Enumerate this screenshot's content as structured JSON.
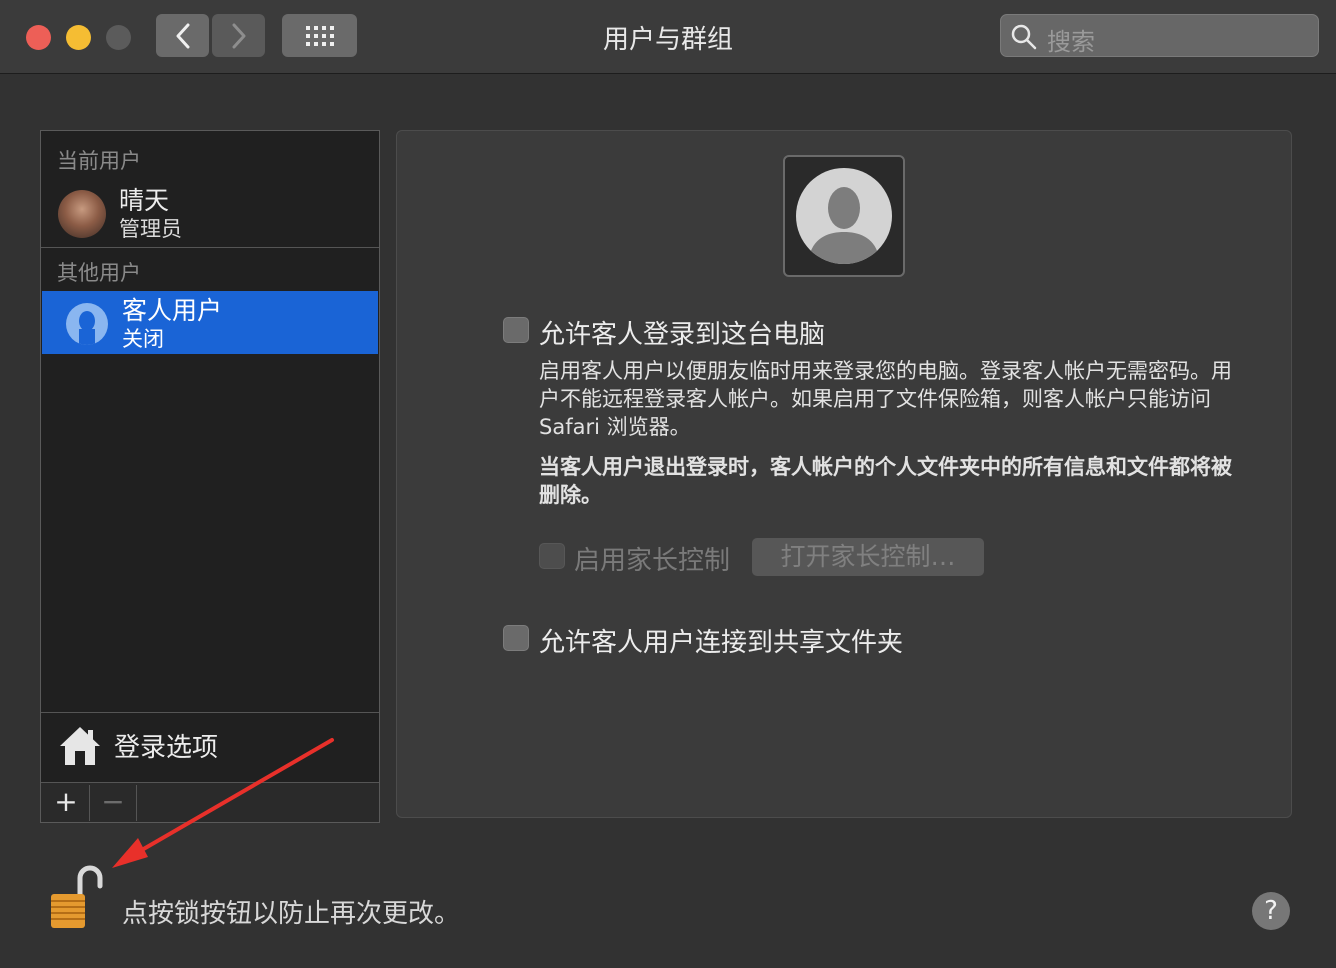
{
  "window": {
    "title": "用户与群组"
  },
  "search": {
    "placeholder": "搜索"
  },
  "sidebar": {
    "current_users_header": "当前用户",
    "current_user": {
      "name": "晴天",
      "role": "管理员"
    },
    "other_users_header": "其他用户",
    "guest_user": {
      "name": "客人用户",
      "status": "关闭"
    },
    "login_options_label": "登录选项",
    "add_symbol": "+",
    "remove_symbol": "−"
  },
  "guest_panel": {
    "allow_login_label": "允许客人登录到这台电脑",
    "description": "启用客人用户以便朋友临时用来登录您的电脑。登录客人帐户无需密码。用户不能远程登录客人帐户。如果启用了文件保险箱，则客人帐户只能访问 Safari 浏览器。",
    "warning": "当客人用户退出登录时，客人帐户的个人文件夹中的所有信息和文件都将被删除。",
    "parental_controls_label": "启用家长控制",
    "open_parental_controls_button": "打开家长控制…",
    "allow_shared_folders_label": "允许客人用户连接到共享文件夹"
  },
  "footer": {
    "lock_message": "点按锁按钮以防止再次更改。",
    "help_symbol": "?"
  },
  "colors": {
    "selection": "#1a64d6",
    "annotation_arrow": "#e8302a"
  }
}
